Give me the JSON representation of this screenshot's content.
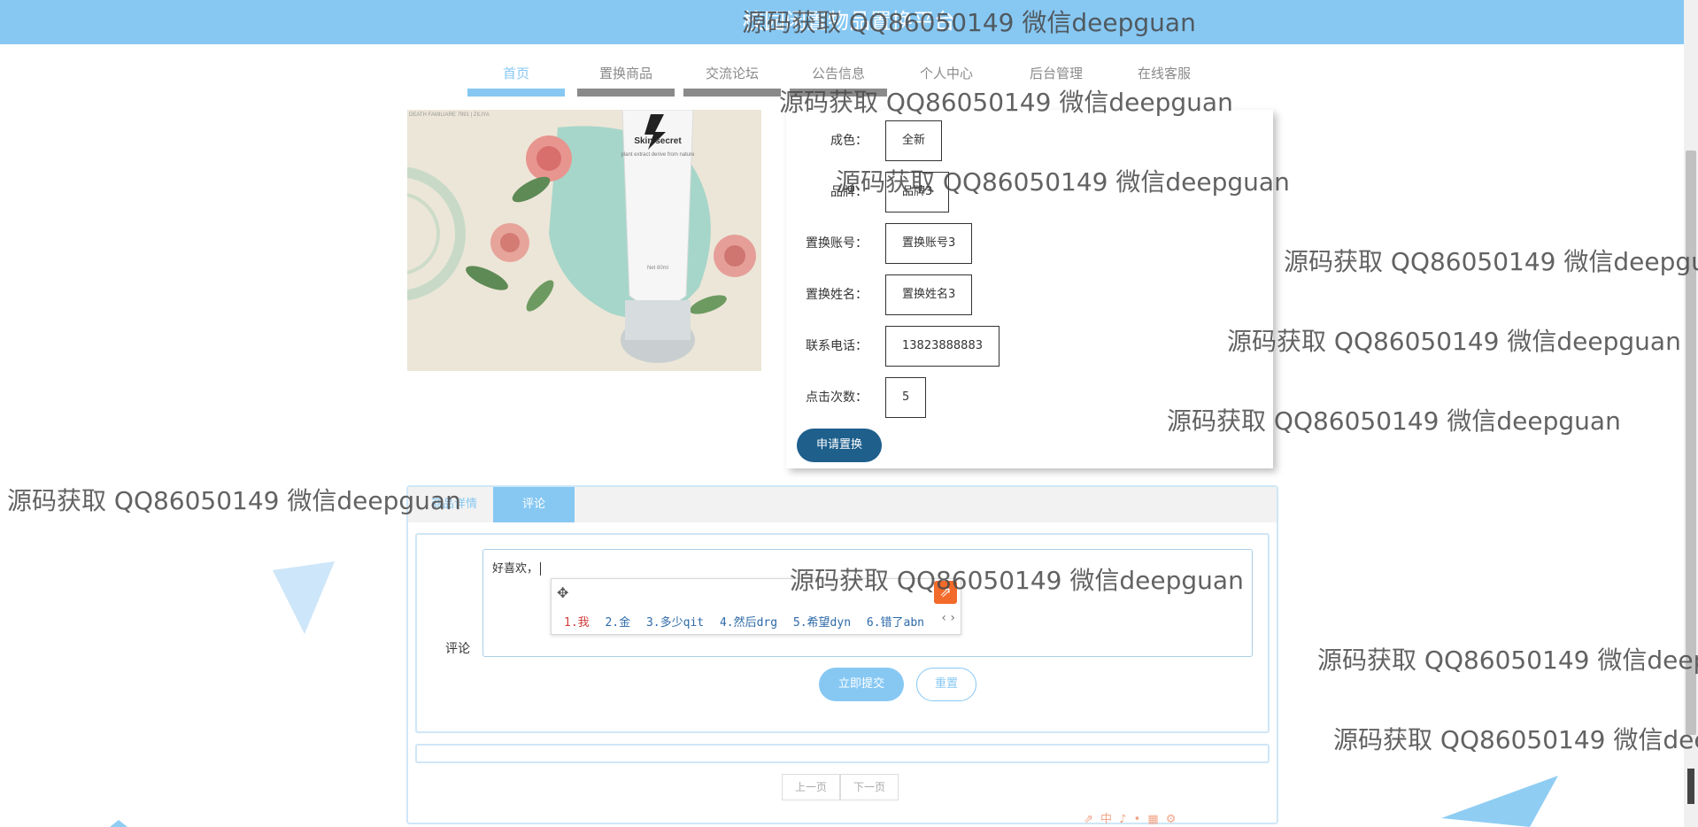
{
  "header": {
    "title": "校园闲置物品置换平台"
  },
  "nav": [
    {
      "label": "首页",
      "active": true
    },
    {
      "label": "置换商品"
    },
    {
      "label": "交流论坛"
    },
    {
      "label": "公告信息"
    },
    {
      "label": "个人中心"
    },
    {
      "label": "后台管理"
    },
    {
      "label": "在线客服"
    }
  ],
  "product_image": {
    "brand_text": "Skin secret",
    "sub_text": "plant extract derive from nature",
    "corner_text": "DEATH FAMILIARE 7991 | ZILIYA",
    "volume_text": "Net 80ml"
  },
  "details": [
    {
      "label": "成色：",
      "value": "全新"
    },
    {
      "label": "品牌：",
      "value": "品牌3"
    },
    {
      "label": "置换账号：",
      "value": "置换账号3"
    },
    {
      "label": "置换姓名：",
      "value": "置换姓名3"
    },
    {
      "label": "联系电话：",
      "value": "13823888883"
    },
    {
      "label": "点击次数：",
      "value": "5"
    }
  ],
  "apply_button": "申请置换",
  "tabs": [
    {
      "label": "商品详情"
    },
    {
      "label": "评论",
      "active": true
    }
  ],
  "comment": {
    "label": "评论",
    "typed_text": "好喜欢，",
    "submit": "立即提交",
    "reset": "重置"
  },
  "ime": {
    "candidates": [
      "1.我",
      "2.金",
      "3.多少qit",
      "4.然后drg",
      "5.希望dyn",
      "6.错了abn"
    ],
    "arrows": "‹ ›"
  },
  "pagination": {
    "prev": "上一页",
    "next": "下一页"
  },
  "watermark_text": "源码获取 QQ86050149 微信deepguan",
  "colors": {
    "accent": "#87c8f3",
    "primary_button": "#1e5f8c"
  }
}
